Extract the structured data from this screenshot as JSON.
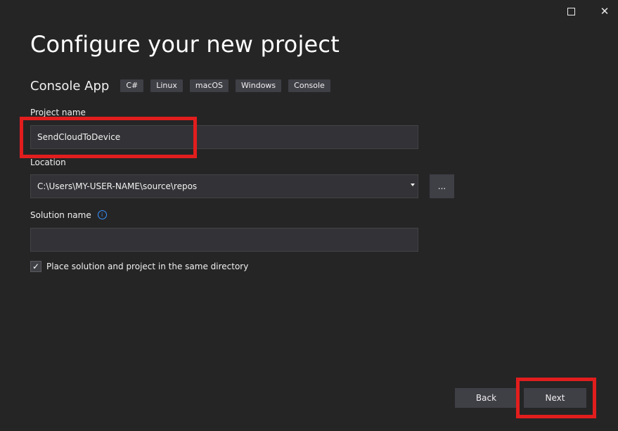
{
  "window": {
    "maximize_icon": "maximize-icon",
    "close_icon": "close-icon",
    "close_glyph": "✕"
  },
  "header": {
    "title": "Configure your new project"
  },
  "template": {
    "name": "Console App",
    "tags": [
      "C#",
      "Linux",
      "macOS",
      "Windows",
      "Console"
    ]
  },
  "form": {
    "project_name_label": "Project name",
    "project_name_value": "SendCloudToDevice",
    "location_label": "Location",
    "location_value": "C:\\Users\\MY-USER-NAME\\source\\repos",
    "browse_label": "...",
    "solution_name_label": "Solution name",
    "solution_name_value": "",
    "info_glyph": "i",
    "same_directory_label": "Place solution and project in the same directory",
    "same_directory_checked": true,
    "check_glyph": "✓"
  },
  "footer": {
    "back_label": "Back",
    "next_label": "Next"
  },
  "colors": {
    "background": "#252526",
    "field_background": "#333337",
    "button_background": "#3f3f46",
    "highlight": "#e21d1d",
    "info_accent": "#3794ff"
  }
}
